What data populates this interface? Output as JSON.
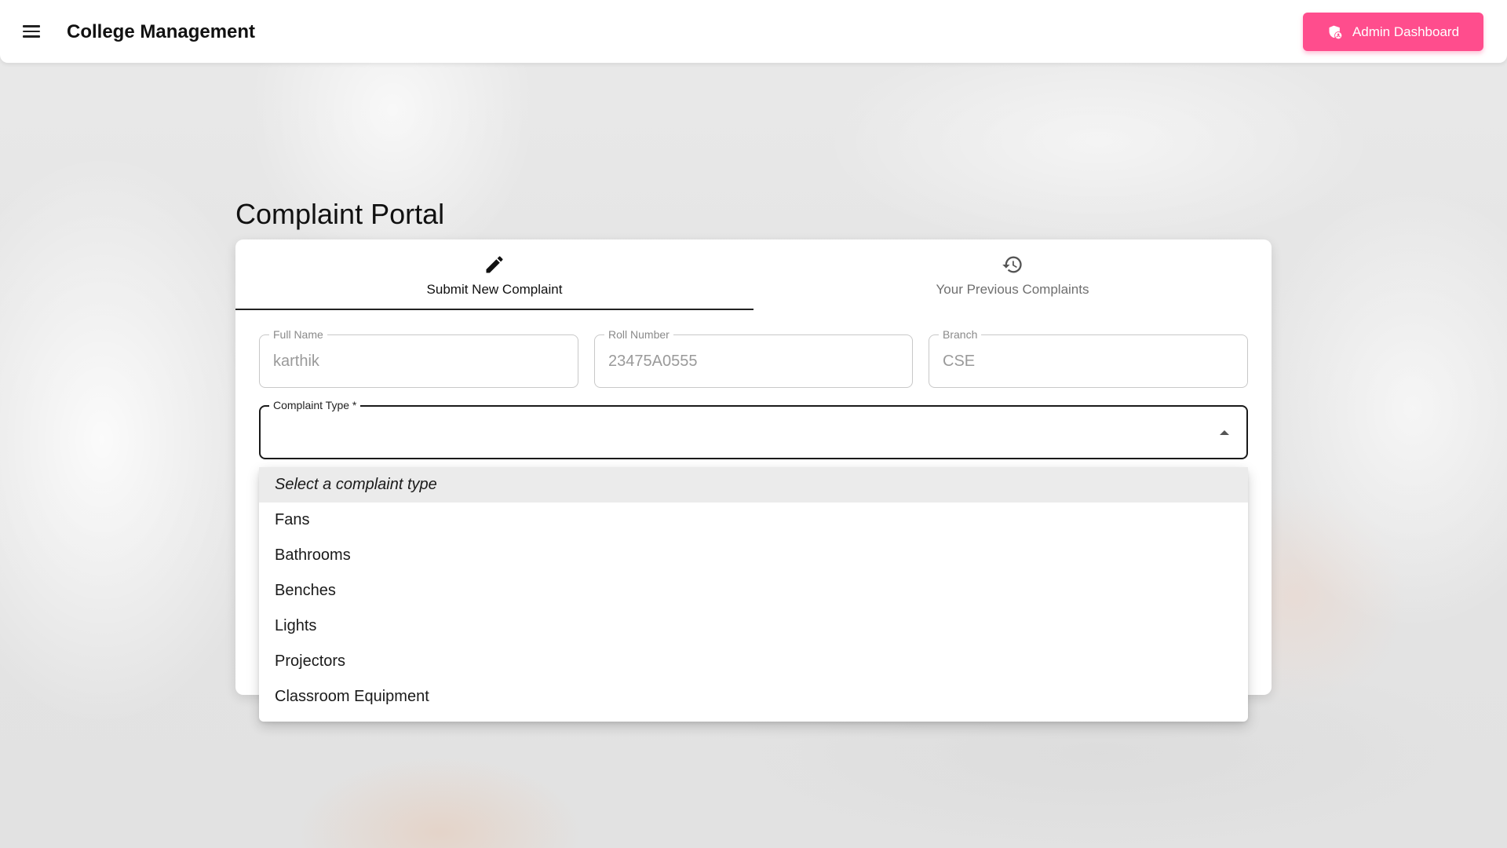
{
  "header": {
    "title": "College Management",
    "admin_button_label": "Admin Dashboard"
  },
  "page": {
    "title": "Complaint Portal"
  },
  "tabs": [
    {
      "label": "Submit New Complaint",
      "icon": "pencil-icon",
      "active": true
    },
    {
      "label": "Your Previous Complaints",
      "icon": "history-icon",
      "active": false
    }
  ],
  "form": {
    "full_name": {
      "label": "Full Name",
      "value": "karthik"
    },
    "roll_number": {
      "label": "Roll Number",
      "value": "23475A0555"
    },
    "branch": {
      "label": "Branch",
      "value": "CSE"
    },
    "complaint_type": {
      "label": "Complaint Type *",
      "value": ""
    }
  },
  "dropdown": {
    "options": [
      "Select a complaint type",
      "Fans",
      "Bathrooms",
      "Benches",
      "Lights",
      "Projectors",
      "Classroom Equipment"
    ]
  },
  "colors": {
    "accent": "#ff4d8d",
    "card": "#ffffff",
    "tab_indicator": "#222222"
  }
}
